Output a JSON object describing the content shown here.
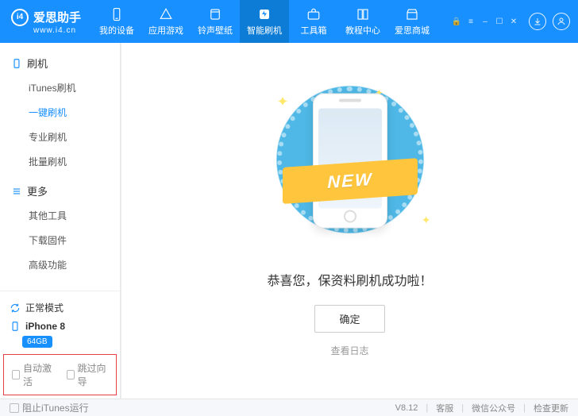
{
  "header": {
    "logo_mark": "i4",
    "title": "爱思助手",
    "subtitle": "www.i4.cn",
    "nav": [
      {
        "key": "device",
        "label": "我的设备"
      },
      {
        "key": "apps",
        "label": "应用游戏"
      },
      {
        "key": "ringtone",
        "label": "铃声壁纸"
      },
      {
        "key": "flash",
        "label": "智能刷机",
        "active": true
      },
      {
        "key": "toolbox",
        "label": "工具箱"
      },
      {
        "key": "tutorial",
        "label": "教程中心"
      },
      {
        "key": "store",
        "label": "爱思商城"
      }
    ]
  },
  "sidebar": {
    "section_flash": "刷机",
    "section_more": "更多",
    "flash_items": [
      {
        "key": "itunes",
        "label": "iTunes刷机"
      },
      {
        "key": "onekey",
        "label": "一键刷机",
        "active": true
      },
      {
        "key": "pro",
        "label": "专业刷机"
      },
      {
        "key": "batch",
        "label": "批量刷机"
      }
    ],
    "more_items": [
      {
        "key": "othertools",
        "label": "其他工具"
      },
      {
        "key": "firmware",
        "label": "下载固件"
      },
      {
        "key": "advanced",
        "label": "高级功能"
      }
    ],
    "mode": "正常模式",
    "device": "iPhone 8",
    "storage": "64GB",
    "check_auto_activate": "自动激活",
    "check_skip_wizard": "跳过向导"
  },
  "main": {
    "ribbon": "NEW",
    "message": "恭喜您，保资料刷机成功啦！",
    "confirm": "确定",
    "viewlog": "查看日志"
  },
  "statusbar": {
    "block_itunes": "阻止iTunes运行",
    "version": "V8.12",
    "support": "客服",
    "wechat": "微信公众号",
    "update": "检查更新"
  }
}
